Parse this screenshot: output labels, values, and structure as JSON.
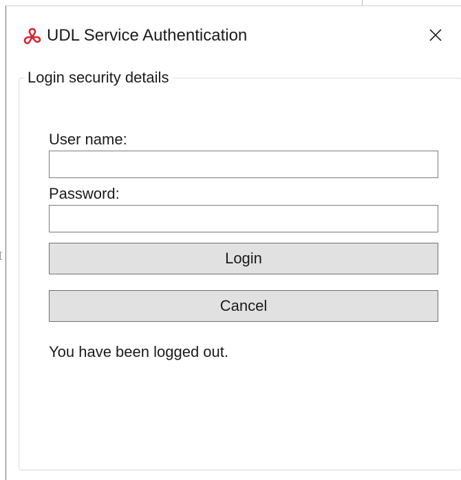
{
  "dialog": {
    "title": "UDL Service Authentication",
    "icon": "red-knot-logo-icon",
    "close_icon": "close-icon"
  },
  "group": {
    "legend": "Login security details"
  },
  "form": {
    "username_label": "User name:",
    "username_value": "",
    "password_label": "Password:",
    "password_value": "",
    "login_label": "Login",
    "cancel_label": "Cancel"
  },
  "status": {
    "message": "You have been logged out."
  },
  "colors": {
    "accent": "#d9232a",
    "button_bg": "#e1e1e1",
    "text": "#1a1a1a"
  }
}
